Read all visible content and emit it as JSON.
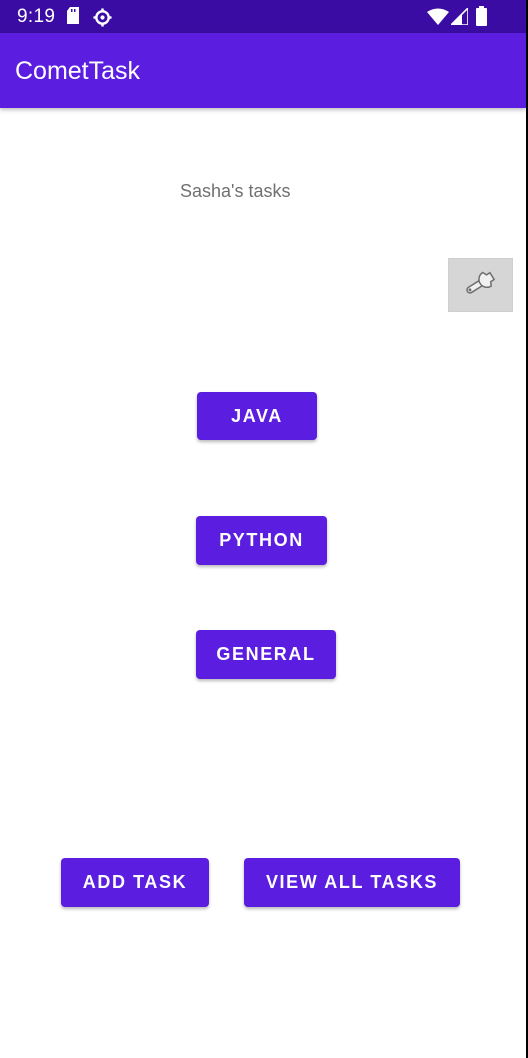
{
  "status_bar": {
    "time": "9:19",
    "left_icons": [
      "sd-card-icon",
      "settings-gear-icon"
    ],
    "right_icons": [
      "wifi-icon",
      "cell-signal-icon",
      "battery-icon"
    ]
  },
  "app_bar": {
    "title": "CometTask"
  },
  "main": {
    "subtitle": "Sasha's tasks",
    "settings_icon": "wrench-icon",
    "categories": [
      {
        "label": "JAVA"
      },
      {
        "label": "PYTHON"
      },
      {
        "label": "GENERAL"
      }
    ],
    "actions": {
      "add_task_label": "ADD TASK",
      "view_all_label": "VIEW ALL TASKS"
    }
  },
  "colors": {
    "primary": "#5b1ee0",
    "status_bar": "#3a0ca3",
    "subtitle_text": "#707070",
    "settings_button_bg": "#d6d6d6"
  }
}
